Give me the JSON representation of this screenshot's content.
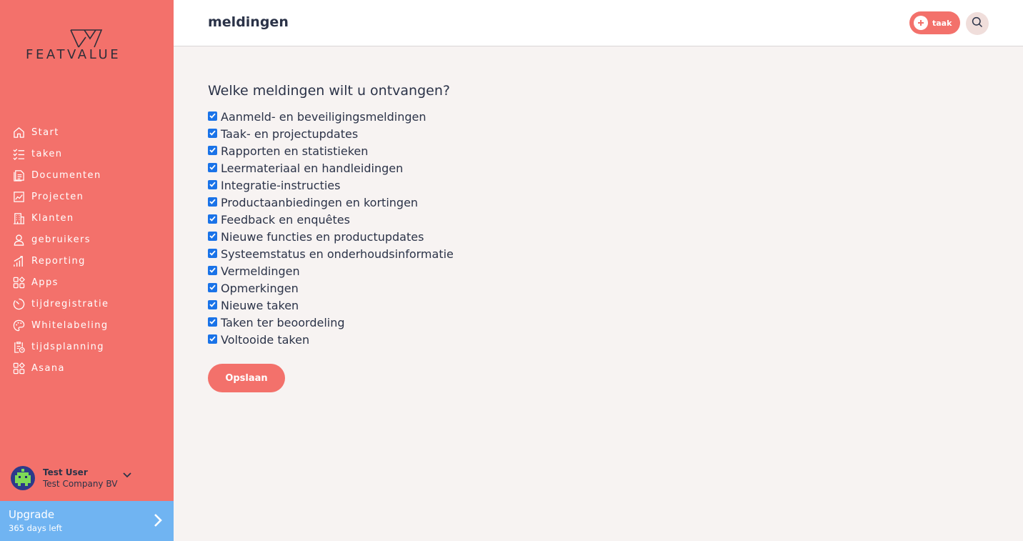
{
  "brand": {
    "logo_text": "FEATVALUE",
    "accent": "#f3716b",
    "upgrade_color": "#70b4f2"
  },
  "sidebar": {
    "items": [
      {
        "label": "Start",
        "icon": "home-icon"
      },
      {
        "label": "taken",
        "icon": "checklist-icon"
      },
      {
        "label": "Documenten",
        "icon": "document-icon"
      },
      {
        "label": "Projecten",
        "icon": "chart-icon"
      },
      {
        "label": "Klanten",
        "icon": "building-icon"
      },
      {
        "label": "gebruikers",
        "icon": "user-icon"
      },
      {
        "label": "Reporting",
        "icon": "bar-chart-icon"
      },
      {
        "label": "Apps",
        "icon": "apps-icon"
      },
      {
        "label": "tijdregistratie",
        "icon": "timer-icon"
      },
      {
        "label": "Whitelabeling",
        "icon": "palette-icon"
      },
      {
        "label": "tijdsplanning",
        "icon": "clipboard-clock-icon"
      },
      {
        "label": "Asana",
        "icon": "apps-icon"
      }
    ],
    "user": {
      "name": "Test User",
      "company": "Test Company BV"
    },
    "upgrade": {
      "title": "Upgrade",
      "subtitle": "365 days left"
    }
  },
  "header": {
    "title": "meldingen",
    "add_task_label": "taak"
  },
  "main": {
    "question": "Welke meldingen wilt u ontvangen?",
    "options": [
      {
        "label": "Aanmeld- en beveiligingsmeldingen",
        "checked": true
      },
      {
        "label": "Taak- en projectupdates",
        "checked": true
      },
      {
        "label": "Rapporten en statistieken",
        "checked": true
      },
      {
        "label": "Leermateriaal en handleidingen",
        "checked": true
      },
      {
        "label": "Integratie-instructies",
        "checked": true
      },
      {
        "label": "Productaanbiedingen en kortingen",
        "checked": true
      },
      {
        "label": "Feedback en enquêtes",
        "checked": true
      },
      {
        "label": "Nieuwe functies en productupdates",
        "checked": true
      },
      {
        "label": "Systeemstatus en onderhoudsinformatie",
        "checked": true
      },
      {
        "label": "Vermeldingen",
        "checked": true
      },
      {
        "label": "Opmerkingen",
        "checked": true
      },
      {
        "label": "Nieuwe taken",
        "checked": true
      },
      {
        "label": "Taken ter beoordeling",
        "checked": true
      },
      {
        "label": "Voltooide taken",
        "checked": true
      }
    ],
    "save_label": "Opslaan"
  }
}
